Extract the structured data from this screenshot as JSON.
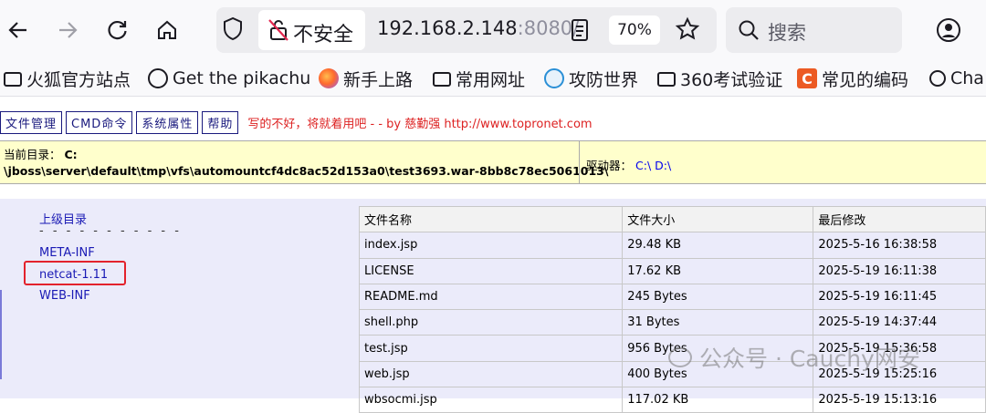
{
  "browser": {
    "insecure_label": "不安全",
    "url_host": "192.168.2.148",
    "url_port": ":8080/",
    "zoom": "70%",
    "search_placeholder": "搜索"
  },
  "bookmarks": [
    {
      "icon": "folder-icon",
      "label": "火狐官方站点"
    },
    {
      "icon": "globe-icon",
      "label": "Get the pikachu"
    },
    {
      "icon": "firefox-icon",
      "label": "新手上路"
    },
    {
      "icon": "folder-icon",
      "label": "常用网址"
    },
    {
      "icon": "gongfang-icon",
      "label": "攻防世界"
    },
    {
      "icon": "folder-icon",
      "label": "360考试验证"
    },
    {
      "icon": "c-icon",
      "label": "常见的编码"
    },
    {
      "icon": "chatgpt-icon",
      "label": "Cha"
    }
  ],
  "menu": {
    "file_manage": "文件管理",
    "cmd": "CMD命令",
    "sys_props": "系统属性",
    "help": "帮助",
    "credit": "写的不好，将就着用吧 - - by 慈勤强 http://www.topronet.com"
  },
  "path": {
    "label": "当前目录：",
    "drive": "C:",
    "value": "\\jboss\\server\\default\\tmp\\vfs\\automountcf4dc8ac52d153a0\\test3693.war-8bb8c78ec5061013\\",
    "drives_label": "驱动器：",
    "drive_c": "C:\\",
    "drive_d": "D:\\"
  },
  "dirs": {
    "parent": "上级目录",
    "separator": "- - - - - - - - - - -",
    "items": [
      "META-INF",
      "netcat-1.11",
      "WEB-INF"
    ]
  },
  "table": {
    "headers": [
      "文件名称",
      "文件大小",
      "最后修改"
    ],
    "rows": [
      [
        "index.jsp",
        "29.48 KB",
        "2025-5-16 16:38:58"
      ],
      [
        "LICENSE",
        "17.62 KB",
        "2025-5-19 16:11:38"
      ],
      [
        "README.md",
        "245 Bytes",
        "2025-5-19 16:11:45"
      ],
      [
        "shell.php",
        "31 Bytes",
        "2025-5-19 14:37:44"
      ],
      [
        "test.jsp",
        "956 Bytes",
        "2025-5-19 15:36:58"
      ],
      [
        "web.jsp",
        "400 Bytes",
        "2025-5-19 15:25:16"
      ],
      [
        "wbsocmi.jsp",
        "117.02 KB",
        "2025-5-19 15:13:16"
      ]
    ]
  },
  "watermark": "公众号 · Cauchy网安",
  "colors": {
    "highlight": "#e3222c",
    "link": "#1a1ab5",
    "pathbar_bg": "#ffffcc"
  }
}
